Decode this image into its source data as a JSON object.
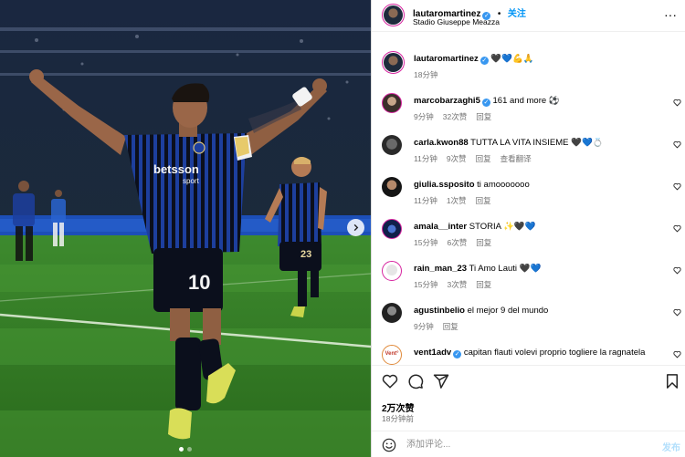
{
  "post": {
    "username": "lautaromartinez",
    "follow_label": "关注",
    "location": "Stadio Giuseppe Meazza",
    "caption_emojis": "🖤💙💪🙏",
    "caption_time": "18分钟",
    "likes": "2万次赞",
    "posted_ago": "18分钟前",
    "shirt_sponsor": "betsson",
    "shirt_sponsor_sub": "sport",
    "shirt_number": "10",
    "shirt_number_2": "23"
  },
  "comments": [
    {
      "user": "marcobarzaghi5",
      "verified": true,
      "text": "161 and more ⚽",
      "time": "9分钟",
      "likes": "32次赞",
      "reply": "回复",
      "translate": ""
    },
    {
      "user": "carla.kwon88",
      "verified": false,
      "text": "TUTTA LA VITA INSIEME 🖤💙💍",
      "time": "11分钟",
      "likes": "9次赞",
      "reply": "回复",
      "translate": "查看翻译"
    },
    {
      "user": "giulia.ssposito",
      "verified": false,
      "text": "ti amooooooo",
      "time": "11分钟",
      "likes": "1次赞",
      "reply": "回复",
      "translate": ""
    },
    {
      "user": "amala__inter",
      "verified": false,
      "text": "STORIA ✨🖤💙",
      "time": "15分钟",
      "likes": "6次赞",
      "reply": "回复",
      "translate": ""
    },
    {
      "user": "rain_man_23",
      "verified": false,
      "text": "Ti Amo Lauti 🖤💙",
      "time": "15分钟",
      "likes": "3次赞",
      "reply": "回复",
      "translate": ""
    },
    {
      "user": "agustinbelio",
      "verified": false,
      "text": "el mejor 9 del mundo",
      "time": "9分钟",
      "likes": "",
      "reply": "回复",
      "translate": ""
    },
    {
      "user": "vent1adv",
      "verified": true,
      "text": "capitan flauti volevi proprio togliere la ragnatela",
      "time": "",
      "likes": "",
      "reply": "",
      "translate": ""
    }
  ],
  "composer": {
    "placeholder": "添加评论...",
    "post_label": "发布"
  },
  "avatar_badges": {
    "vent1adv": "Vent°"
  },
  "colors": {
    "inter_blue": "#1a3c9c",
    "link_blue": "#0095f6",
    "story_ring": "#d6249f",
    "muted": "#737373"
  },
  "icons": [
    "heart-icon",
    "comment-icon",
    "share-icon",
    "bookmark-icon",
    "emoji-icon",
    "more-icon",
    "verified-icon",
    "chevron-right-icon"
  ]
}
